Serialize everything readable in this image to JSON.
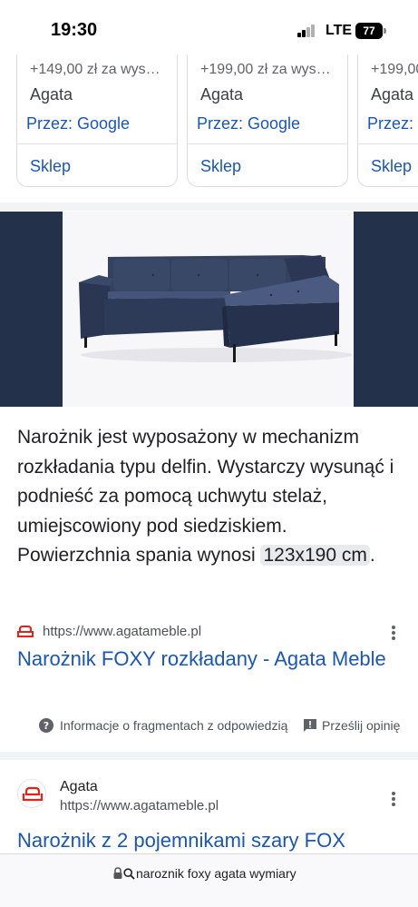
{
  "status_bar": {
    "time": "19:30",
    "network": "LTE",
    "battery": "77"
  },
  "shopping_cards": [
    {
      "price": "+149,00 zł za wys…",
      "seller": "Agata",
      "via": "Przez: Google",
      "button": "Sklep"
    },
    {
      "price": "+199,00 zł za wys…",
      "seller": "Agata",
      "via": "Przez: Google",
      "button": "Sklep"
    },
    {
      "price": "+199,00",
      "seller": "Agata",
      "via": "Przez:",
      "button": "Sklep"
    }
  ],
  "featured_snippet": {
    "text_before": "Narożnik jest wyposażony w mechanizm rozkładania typu delfin. Wystarczy wysunąć i podnieść za pomocą uchwytu stelaż, umiejscowiony pod siedziskiem. Powierzchnia spania wynosi ",
    "highlight": "123x190 cm",
    "text_after": ".",
    "source_url": "https://www.agatameble.pl",
    "title": "Narożnik FOXY rozkładany - Agata Meble"
  },
  "feedback": {
    "about": "Informacje o fragmentach z odpowiedzią",
    "send": "Prześlij opinię"
  },
  "result2": {
    "site_name": "Agata",
    "url": "https://www.agatameble.pl",
    "title": "Narożnik z 2 pojemnikami szary FOX"
  },
  "url_bar": {
    "query": "naroznik foxy agata wymiary"
  },
  "colors": {
    "link": "#1a56b8",
    "image_background": "#23314a",
    "sofa": "#2f3c5c",
    "brand": "#e2231a"
  },
  "icons": {
    "info": "info-icon",
    "feedback": "feedback-icon",
    "more": "more-vert-icon",
    "lock": "lock-icon",
    "search": "search-icon",
    "favicon": "sofa-logo-icon"
  }
}
